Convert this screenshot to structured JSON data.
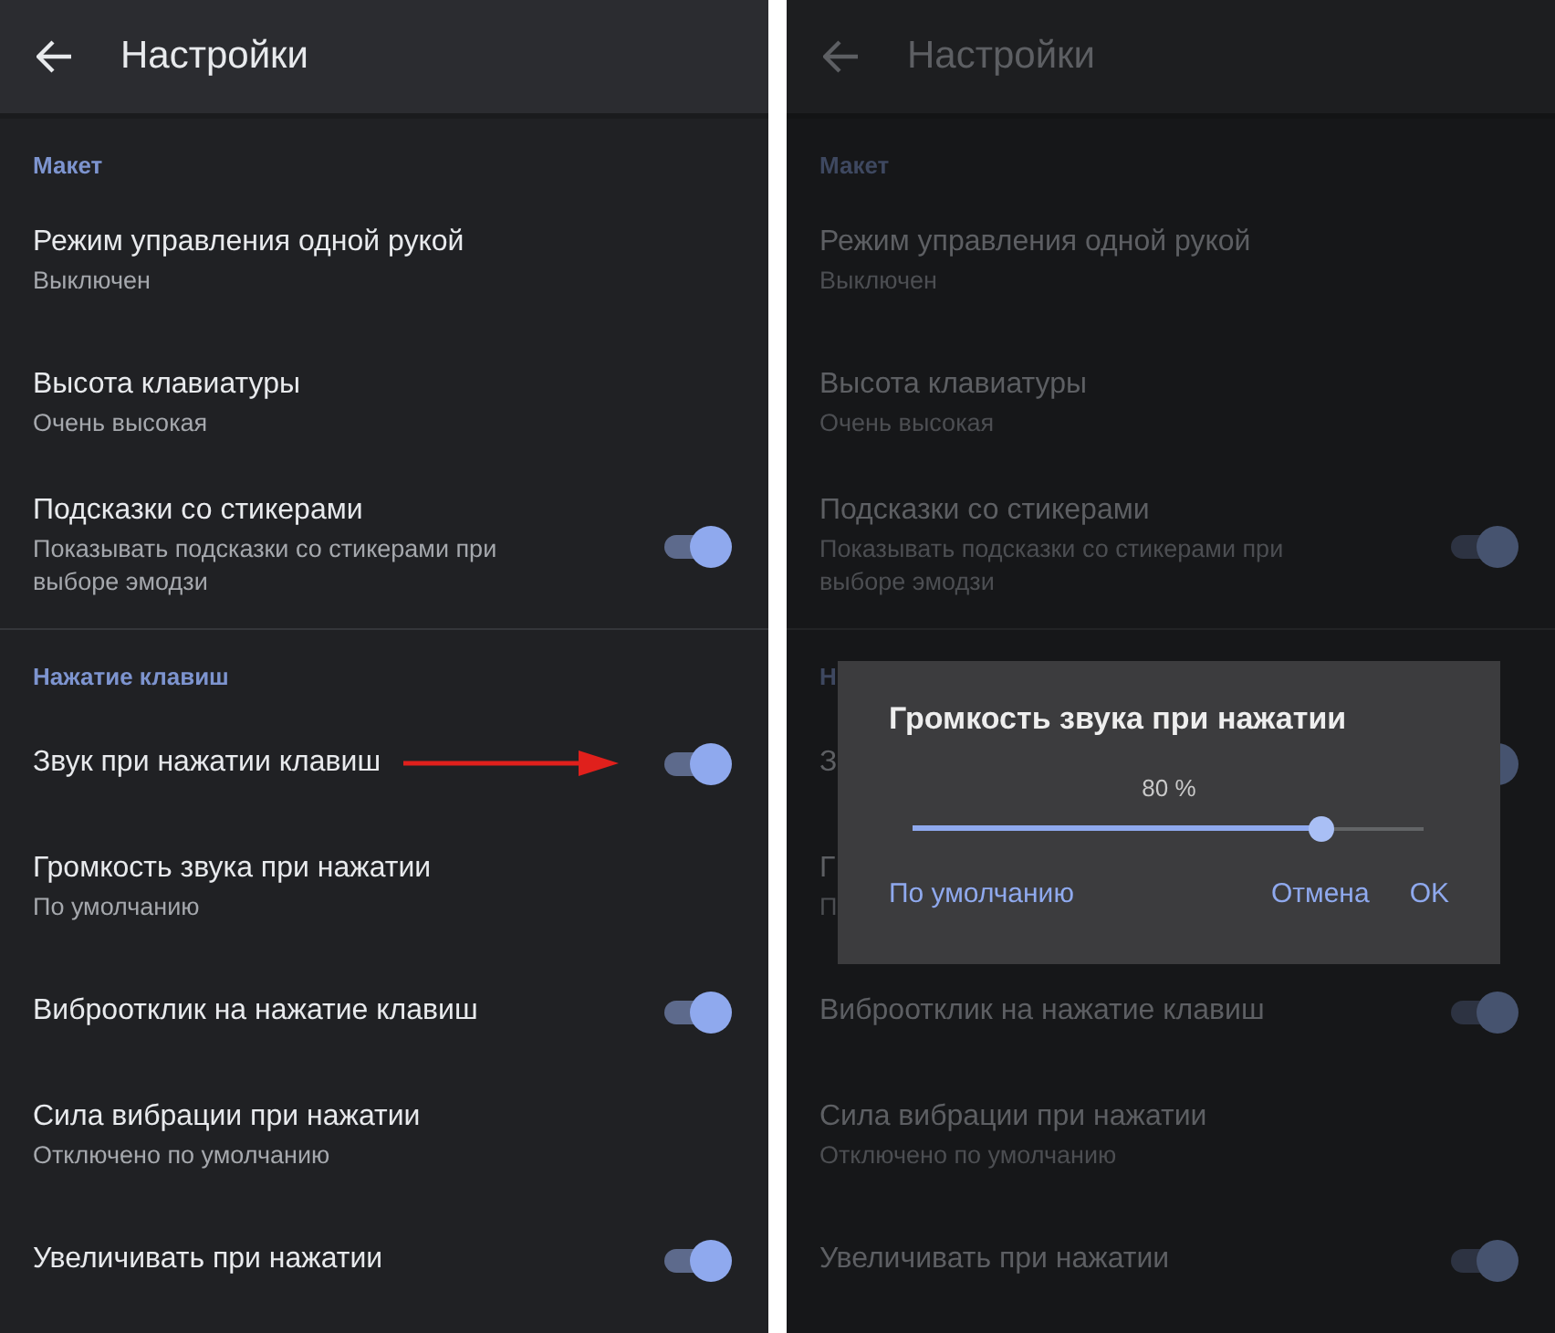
{
  "settings_screen": {
    "title": "Настройки",
    "sections": [
      {
        "label": "Макет",
        "items": [
          {
            "kind": "text",
            "title": "Режим управления одной рукой",
            "subtitle": "Выключен"
          },
          {
            "kind": "text",
            "title": "Высота клавиатуры",
            "subtitle": "Очень высокая"
          },
          {
            "kind": "toggle",
            "title": "Подсказки со стикерами",
            "subtitle": "Показывать подсказки со стикерами при выборе эмодзи",
            "on": true
          }
        ]
      },
      {
        "label": "Нажатие клавиш",
        "items": [
          {
            "kind": "toggle",
            "title": "Звук при нажатии клавиш",
            "on": true,
            "pointed_at": true
          },
          {
            "kind": "text",
            "title": "Громкость звука при нажатии",
            "subtitle": "По умолчанию"
          },
          {
            "kind": "toggle",
            "title": "Виброотклик на нажатие клавиш",
            "on": true,
            "pointed_at": false
          },
          {
            "kind": "text",
            "title": "Сила вибрации при нажатии",
            "subtitle": "Отключено по умолчанию"
          },
          {
            "kind": "toggle",
            "title": "Увеличивать при нажатии",
            "on": true,
            "pointed_at": false
          }
        ]
      }
    ]
  },
  "dimmed_screen": {
    "title": "Настройки",
    "sections": [
      {
        "label": "Макет",
        "items": [
          {
            "kind": "text",
            "title": "Режим управления одной рукой",
            "subtitle": "Выключен"
          },
          {
            "kind": "text",
            "title": "Высота клавиатуры",
            "subtitle": "Очень высокая"
          },
          {
            "kind": "toggle",
            "title": "Подсказки со стикерами",
            "subtitle": "Показывать подсказки со стикерами при выборе эмодзи",
            "on": true
          }
        ]
      },
      {
        "label": "Н",
        "items": [
          {
            "kind": "toggle",
            "title": "З",
            "on": true
          },
          {
            "kind": "text",
            "title": "Г",
            "subtitle": "П"
          },
          {
            "kind": "toggle",
            "title": "Виброотклик на нажатие клавиш",
            "on": true
          },
          {
            "kind": "text",
            "title": "Сила вибрации при нажатии",
            "subtitle": "Отключено по умолчанию"
          },
          {
            "kind": "toggle",
            "title": "Увеличивать при нажатии",
            "on": true
          }
        ]
      }
    ],
    "dialog": {
      "title": "Громкость звука при нажатии",
      "reading": "80 %",
      "level": 0.8,
      "buttons": [
        "По умолчанию",
        "Отмена",
        "OK"
      ]
    }
  }
}
